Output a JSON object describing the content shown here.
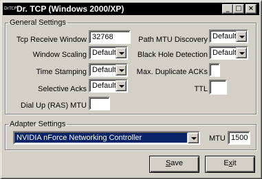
{
  "window": {
    "title": "Dr. TCP (Windows 2000/XP)",
    "icon_text": "DrTCP",
    "controls": {
      "minimize": "_",
      "maximize": "□",
      "close": "×"
    }
  },
  "general": {
    "legend": "General Settings",
    "tcp_receive_window": {
      "label": "Tcp Receive Window",
      "value": "32768"
    },
    "window_scaling": {
      "label": "Window Scaling",
      "value": "Default"
    },
    "time_stamping": {
      "label": "Time Stamping",
      "value": "Default"
    },
    "selective_acks": {
      "label": "Selective Acks",
      "value": "Default"
    },
    "dial_up_mtu": {
      "label": "Dial Up (RAS) MTU",
      "value": ""
    },
    "path_mtu_discovery": {
      "label": "Path MTU Discovery",
      "value": "Default"
    },
    "black_hole_detection": {
      "label": "Black Hole Detection",
      "value": "Default"
    },
    "max_duplicate_acks": {
      "label": "Max. Duplicate ACKs",
      "value": ""
    },
    "ttl": {
      "label": "TTL",
      "value": ""
    }
  },
  "adapter": {
    "legend": "Adapter Settings",
    "selected": "NVIDIA nForce Networking Controller",
    "mtu_label": "MTU",
    "mtu_value": "1500"
  },
  "buttons": {
    "save": {
      "first": "S",
      "rest": "ave"
    },
    "exit": {
      "first": "x",
      "prefix": "E",
      "rest": "it"
    }
  }
}
